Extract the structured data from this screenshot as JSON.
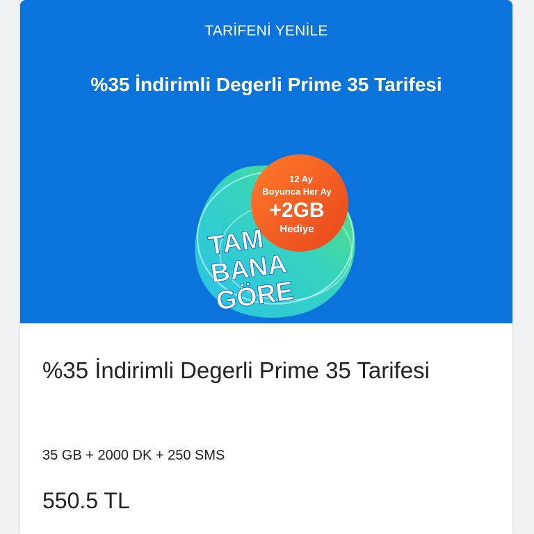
{
  "hero": {
    "kicker": "TARİFENİ YENİLE",
    "title": "%35 İndirimli Degerli Prime 35 Tarifesi"
  },
  "promo_badge": {
    "line1": "12 Ay",
    "line2": "Boyunca Her Ay",
    "amount": "+2GB",
    "gift": "Hediye",
    "slogan_1": "TAM",
    "slogan_2": "BANA",
    "slogan_3": "GÖRE",
    "colors": {
      "orange": "#f25a1e",
      "cyan": "#27c7e6",
      "green": "#4fd86a"
    }
  },
  "plan": {
    "title": "%35 İndirimli Degerli Prime 35 Tarifesi",
    "allowance": "35 GB + 2000 DK + 250 SMS",
    "price": "550.5 TL"
  },
  "colors": {
    "hero_bg": "#0a74dc",
    "text": "#222222"
  }
}
